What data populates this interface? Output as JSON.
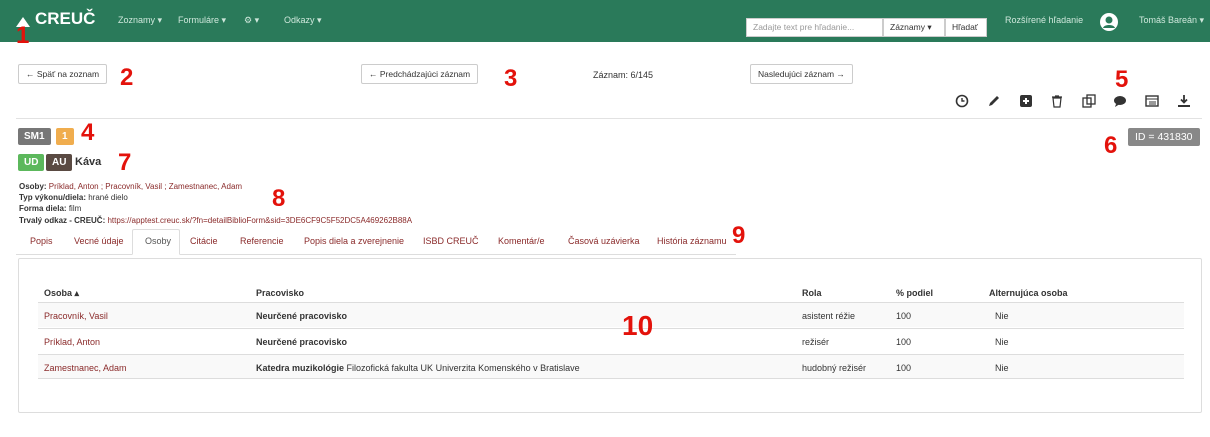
{
  "navbar": {
    "brand": "CREUČ",
    "menu": [
      {
        "label": "Zoznamy ▾"
      },
      {
        "label": "Formuláre ▾"
      },
      {
        "label": "⚙ ▾"
      },
      {
        "label": "Odkazy ▾"
      }
    ],
    "search_placeholder": "Zadajte text pre hľadanie...",
    "search_scope": "Záznamy ▾",
    "search_button": "Hľadať",
    "advanced_search": "Rozšírené hľadanie",
    "user": "Tomáš Bareán ▾"
  },
  "markers": [
    "1",
    "2",
    "3",
    "4",
    "5",
    "6",
    "7",
    "8",
    "9",
    "10"
  ],
  "record_nav": {
    "back": "← Späť na zoznam",
    "prev": "← Predchádzajúci záznam",
    "counter": "Záznam: 6/145",
    "next": "Nasledujúci záznam →"
  },
  "labels": {
    "sm1": "SM1",
    "count": "1",
    "ud": "UD",
    "au": "AU",
    "title": "Káva",
    "id_badge": "ID = 431830"
  },
  "meta": {
    "osoby_label": "Osoby:",
    "osoby_value": "Príklad, Anton ; Pracovník, Vasil ; Zamestnanec, Adam",
    "typ_label": "Typ výkonu/diela:",
    "typ_value": "hrané dielo",
    "forma_label": "Forma diela:",
    "forma_value": "film",
    "odkaz_label": "Trvalý odkaz - CREUČ:",
    "odkaz_value": "https://apptest.creuc.sk/?fn=detailBiblioForm&sid=3DE6CF9C5F52DC5A469262B88A"
  },
  "tabs": [
    {
      "label": "Popis"
    },
    {
      "label": "Vecné údaje"
    },
    {
      "label": "Osoby",
      "active": true
    },
    {
      "label": "Citácie"
    },
    {
      "label": "Referencie"
    },
    {
      "label": "Popis diela a zverejnenie"
    },
    {
      "label": "ISBD CREUČ"
    },
    {
      "label": "Komentár/e"
    },
    {
      "label": "Časová uzávierka"
    },
    {
      "label": "História záznamu"
    }
  ],
  "table": {
    "columns": [
      "Osoba ▴",
      "Pracovisko",
      "Rola",
      "% podiel",
      "Alternujúca osoba"
    ],
    "rows": [
      {
        "osoba": "Pracovník, Vasil",
        "pracovisko_bold": "Neurčené pracovisko",
        "pracovisko_rest": "",
        "rola": "asistent réžie",
        "podiel": "100",
        "alt": "Nie"
      },
      {
        "osoba": "Príklad, Anton",
        "pracovisko_bold": "Neurčené pracovisko",
        "pracovisko_rest": "",
        "rola": "režisér",
        "podiel": "100",
        "alt": "Nie"
      },
      {
        "osoba": "Zamestnanec, Adam",
        "pracovisko_bold": "Katedra muzikológie",
        "pracovisko_rest": " Filozofická fakulta UK Univerzita Komenského v Bratislave",
        "rola": "hudobný režisér",
        "podiel": "100",
        "alt": "Nie"
      }
    ]
  }
}
